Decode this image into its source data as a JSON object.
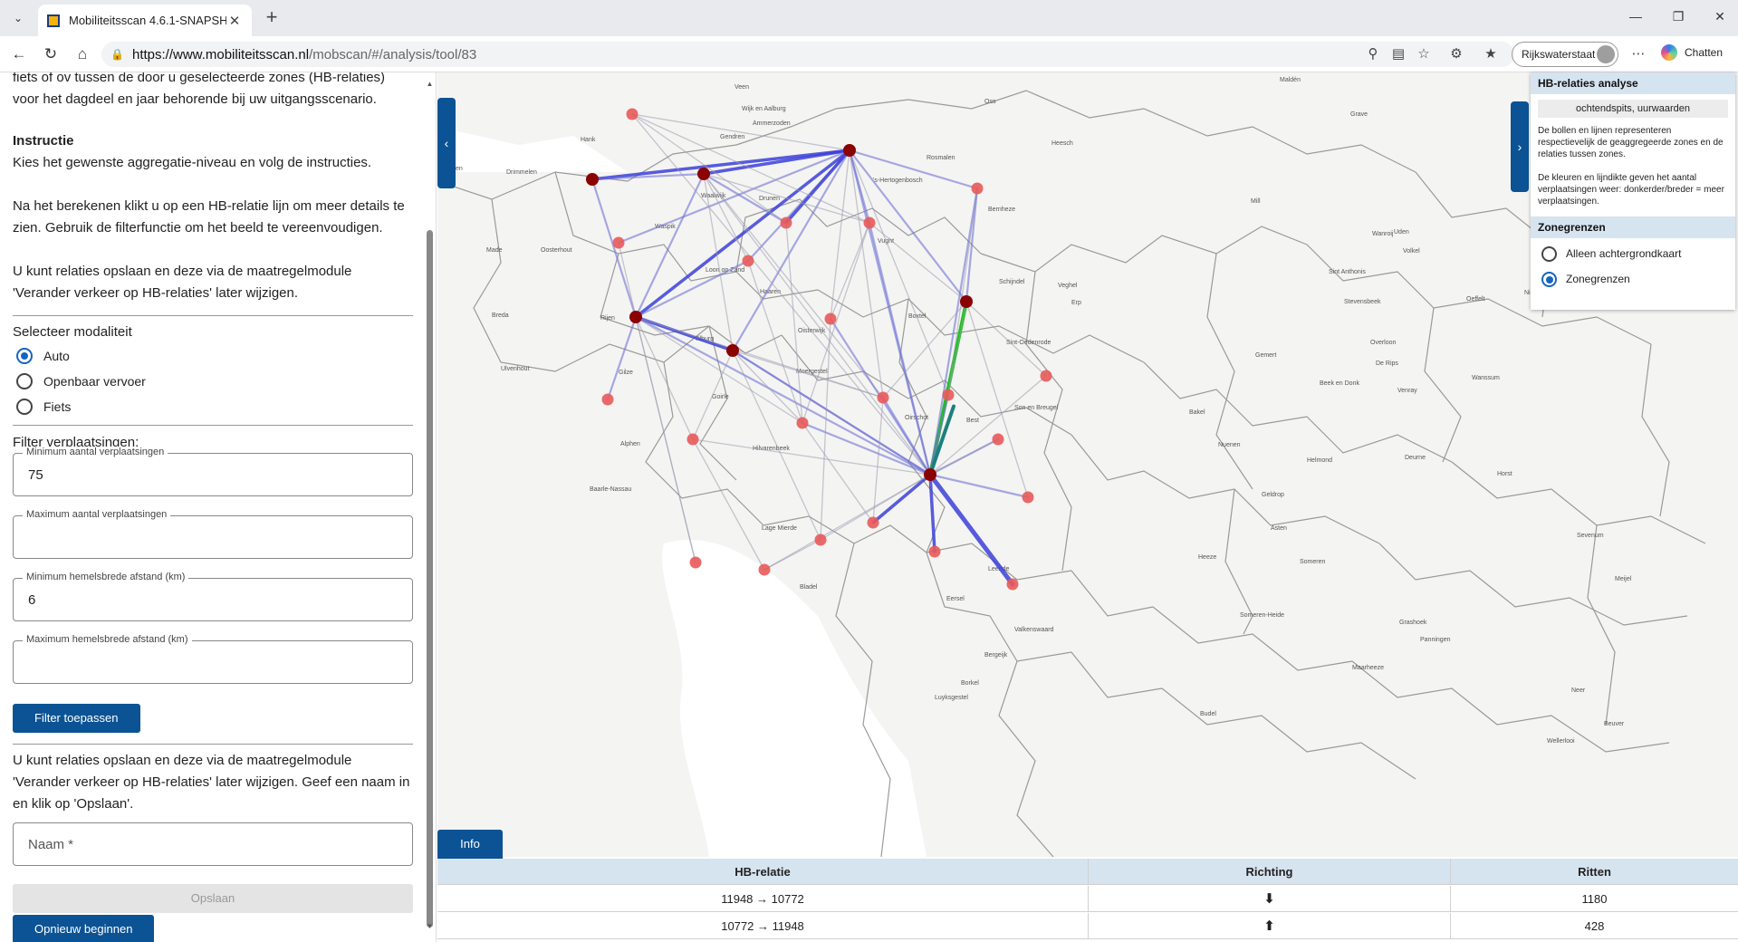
{
  "browser": {
    "tab_title": "Mobiliteitsscan 4.6.1-SNAPSHOT",
    "url_host": "https://www.mobiliteitsscan.nl",
    "url_path": "/mobscan/#/analysis/tool/83",
    "profile_name": "Rijkswaterstaat",
    "chat_label": "Chatten"
  },
  "left": {
    "intro": "fiets of ov tussen de door u geselecteerde zones (HB-relaties) voor het dagdeel en jaar behorende bij uw uitgangsscenario.",
    "instr_title": "Instructie",
    "instr_1": "Kies het gewenste aggregatie-niveau en volg de instructies.",
    "instr_2": "Na het berekenen klikt u op een HB-relatie lijn om meer details te zien. Gebruik de filterfunctie om het beeld te vereenvoudigen.",
    "instr_3": "U kunt relaties opslaan en deze via de maatregelmodule 'Verander verkeer op HB-relaties' later wijzigen.",
    "modality_title": "Selecteer modaliteit",
    "modality": [
      "Auto",
      "Openbaar vervoer",
      "Fiets"
    ],
    "filter_title": "Filter verplaatsingen:",
    "fields": [
      {
        "label": "Minimum aantal verplaatsingen",
        "value": "75"
      },
      {
        "label": "Maximum aantal verplaatsingen",
        "value": ""
      },
      {
        "label": "Minimum hemelsbrede afstand (km)",
        "value": "6"
      },
      {
        "label": "Maximum hemelsbrede afstand (km)",
        "value": ""
      }
    ],
    "filter_button": "Filter toepassen",
    "save_text": "U kunt relaties opslaan en deze via de maatregelmodule 'Verander verkeer op HB-relaties' later wijzigen. Geef een naam in en klik op 'Opslaan'.",
    "name_placeholder": "Naam *",
    "save_button": "Opslaan",
    "restart_button": "Opnieuw beginnen"
  },
  "overlay": {
    "title": "HB-relaties analyse",
    "period": "ochtendspits, uurwaarden",
    "desc_1": "De bollen en lijnen representeren respectievelijk de geaggregeerde zones en de relaties tussen zones.",
    "desc_2": "De kleuren en lijndikte geven het aantal verplaatsingen weer: donkerder/breder = meer verplaatsingen.",
    "zones_title": "Zonegrenzen",
    "zones_options": [
      "Alleen achtergrondkaart",
      "Zonegrenzen"
    ]
  },
  "map": {
    "info_button": "Info",
    "labels": [
      "Veen",
      "Wijk en Aalburg",
      "Ammerzoden",
      "Oss",
      "Maldén",
      "Grave",
      "Gendren",
      "Hank",
      "Rosmalen",
      "Heesch",
      "Dussen",
      "Waalwijk",
      "Drunen",
      "'s-Hertogenbosch",
      "Waspik",
      "Drimmelen",
      "Vught",
      "Bernheze",
      "Mill",
      "Uden",
      "Wanroij",
      "Made",
      "Oosterhout",
      "Loon op Zand",
      "Volkel",
      "Haaren",
      "Schijndel",
      "Veghel",
      "Sint Anthonis",
      "Breda",
      "Rijen",
      "Tilburg",
      "Oisterwijk",
      "Boxtel",
      "Sint-Oedenrode",
      "Erp",
      "Stevensbeek",
      "Oeffelt",
      "Overloon",
      "Gemert",
      "De Rips",
      "Ulvenhout",
      "Gilze",
      "Moergestel",
      "Beek en Donk",
      "Venray",
      "Wanssum",
      "Goirle",
      "Oirschot",
      "Son en Breugel",
      "Best",
      "Bakel",
      "Alphen",
      "Hilvarenbeek",
      "Nuenen",
      "Helmond",
      "Deurne",
      "Horst",
      "Baarle-Nassau",
      "Geldrop",
      "Asten",
      "Sevenum",
      "Lage Mierde",
      "Heeze",
      "Someren",
      "Bladel",
      "Eersel",
      "Leende",
      "Meijel",
      "Someren-Heide",
      "Grashoek",
      "Panningen",
      "Bergeijk",
      "Valkenswaard",
      "Maarheeze",
      "Borkel",
      "Luyksgestel",
      "Budel",
      "Beuver",
      "Neer",
      "Wellerlooi",
      "Nieuw Bergen"
    ]
  },
  "table": {
    "headers": [
      "HB-relatie",
      "Richting",
      "Ritten"
    ],
    "rows": [
      {
        "relation": "11948 → 10772",
        "direction": "down",
        "trips": "1180"
      },
      {
        "relation": "10772 → 11948",
        "direction": "up",
        "trips": "428"
      }
    ]
  },
  "colors": {
    "accent": "#0b5394",
    "line_blue": "#3b3fd8",
    "line_green": "#1ec31e",
    "node_dark": "#8b0000",
    "node_light": "#e85a5a"
  }
}
